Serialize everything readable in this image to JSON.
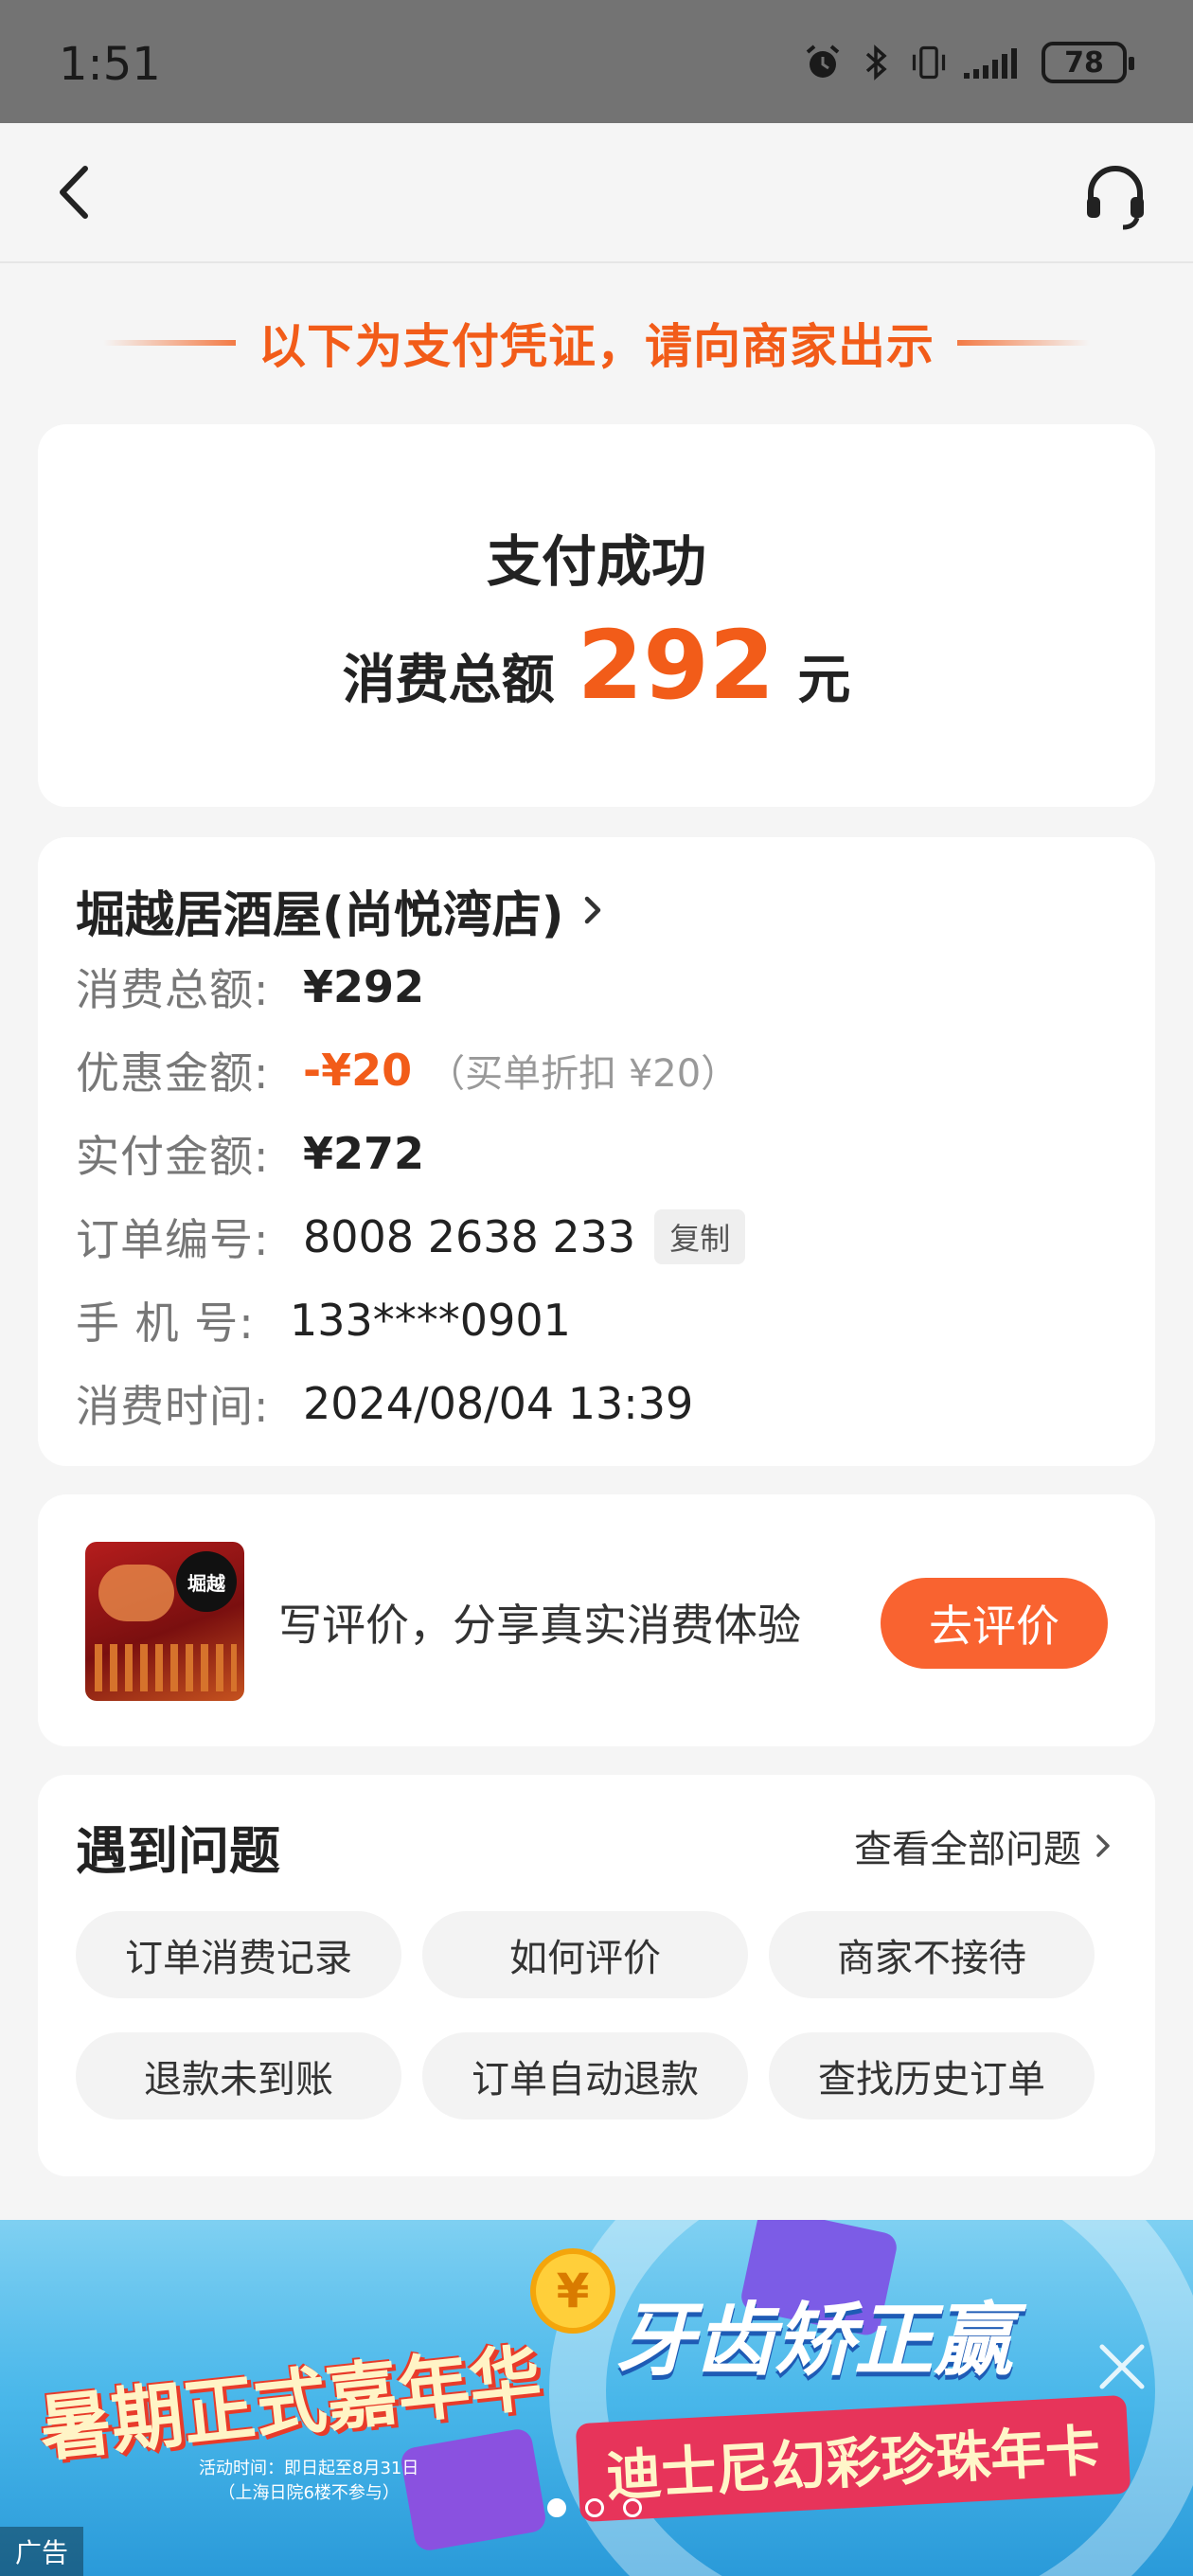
{
  "status_bar": {
    "time": "1:51",
    "battery": "78",
    "icons": [
      "alarm-icon",
      "bluetooth-icon",
      "vibrate-icon",
      "signal-icon",
      "battery-icon"
    ]
  },
  "nav": {
    "back_icon": "chevron-left-icon",
    "service_icon": "headset-icon"
  },
  "voucher_banner": "以下为支付凭证，请向商家出示",
  "success": {
    "title": "支付成功",
    "amount_label": "消费总额",
    "amount_value": "292",
    "amount_unit": "元"
  },
  "details": {
    "store_name": "堀越居酒屋(尚悦湾店)",
    "rows": [
      {
        "label": "消费总额:",
        "value": "¥292"
      },
      {
        "label": "优惠金额:",
        "value": "-¥20",
        "note": "（买单折扣 ¥20）"
      },
      {
        "label": "实付金额:",
        "value": "¥272"
      },
      {
        "label": "订单编号:",
        "value": "8008 2638 233",
        "action": "复制"
      },
      {
        "label": "手 机 号:",
        "value": "133****0901"
      },
      {
        "label": "消费时间:",
        "value": "2024/08/04 13:39"
      }
    ]
  },
  "review": {
    "thumb_logo": "堀越",
    "text": "写评价，分享真实消费体验",
    "button": "去评价"
  },
  "help": {
    "title": "遇到问题",
    "view_all": "查看全部问题",
    "chips": [
      "订单消费记录",
      "如何评价",
      "商家不接待",
      "退款未到账",
      "订单自动退款",
      "查找历史订单"
    ]
  },
  "ad": {
    "left_title": "暑期正式嘉年华",
    "left_note_1": "活动时间：即日起至8月31日",
    "left_note_2": "（上海日院6楼不参与）",
    "right_title": "牙齿矫正赢",
    "right_sub": "迪士尼幻彩珍珠年卡",
    "coin": "¥",
    "tag": "广告",
    "close_icon": "close-icon",
    "dots_active_index": 0
  },
  "colors": {
    "accent": "#f25c19",
    "button": "#f96330",
    "status_bar": "#737373",
    "background": "#f5f5f5"
  }
}
